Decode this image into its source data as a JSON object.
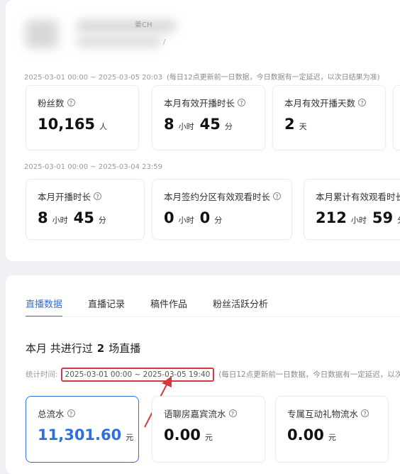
{
  "header": {
    "name_visible": "姜CH",
    "subtext_visible": "/"
  },
  "overview": {
    "range1": "2025-03-01 00:00 ~ 2025-03-05 20:03",
    "note1": "(每日12点更新前一日数据，今日数据有一定延迟，以次日结果为准)",
    "row1": [
      {
        "label": "粉丝数",
        "parts": [
          {
            "num": "10,165",
            "unit": "人"
          }
        ]
      },
      {
        "label": "本月有效开播时长",
        "parts": [
          {
            "num": "8",
            "unit": "小时"
          },
          {
            "num": "45",
            "unit": "分"
          }
        ]
      },
      {
        "label": "本月有效开播天数",
        "parts": [
          {
            "num": "2",
            "unit": "天"
          }
        ]
      }
    ],
    "range2": "2025-03-01 00:00 ~ 2025-03-04 23:59",
    "row2": [
      {
        "label": "本月开播时长",
        "parts": [
          {
            "num": "8",
            "unit": "小时"
          },
          {
            "num": "45",
            "unit": "分"
          }
        ]
      },
      {
        "label": "本月签约分区有效观看时长",
        "parts": [
          {
            "num": "0",
            "unit": "小时"
          },
          {
            "num": "0",
            "unit": "分"
          }
        ]
      },
      {
        "label": "本月累计有效观看时长",
        "parts": [
          {
            "num": "212",
            "unit": "小时"
          },
          {
            "num": "59",
            "unit": "分"
          }
        ]
      }
    ]
  },
  "tabs": [
    "直播数据",
    "直播记录",
    "稿件作品",
    "粉丝活跃分析"
  ],
  "summary": {
    "prefix": "本月 共进行过",
    "count": "2",
    "suffix": "场直播"
  },
  "stat": {
    "label": "统计时间:",
    "range": "2025-03-01 00:00 ~ 2025-03-05 19:40",
    "note": "(每日12点更新前一日数据，今日数据有一定延迟，以次"
  },
  "revenue": [
    {
      "label": "总流水",
      "num": "11,301.60",
      "unit": "元"
    },
    {
      "label": "语聊房嘉宾流水",
      "num": "0.00",
      "unit": "元"
    },
    {
      "label": "专属互动礼物流水",
      "num": "0.00",
      "unit": "元"
    }
  ],
  "colors": {
    "accent": "#2f6fdc",
    "highlight": "#d9363e"
  }
}
